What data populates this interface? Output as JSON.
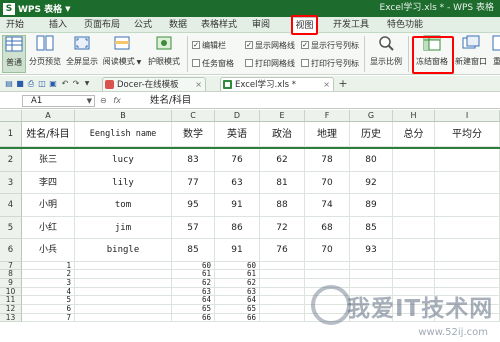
{
  "app": {
    "menu_button": "WPS 表格",
    "title": "Excel学习.xls * - WPS 表格"
  },
  "menu_tabs": [
    "开始",
    "插入",
    "页面布局",
    "公式",
    "数据",
    "表格样式",
    "审阅",
    "视图",
    "开发工具",
    "特色功能"
  ],
  "active_tab": "视图",
  "ribbon": {
    "normal": "普通",
    "page_break": "分页预览",
    "fullscreen": "全屏显示",
    "read_mode": "阅读模式",
    "eye_mode": "护眼模式",
    "checkboxes": [
      {
        "label": "编辑栏",
        "checked": true
      },
      {
        "label": "任务窗格",
        "checked": false
      },
      {
        "label": "显示网格线",
        "checked": true
      },
      {
        "label": "打印网格线",
        "checked": false
      },
      {
        "label": "显示行号列标",
        "checked": true
      },
      {
        "label": "打印行号列标",
        "checked": false
      }
    ],
    "zoom": "显示比例",
    "freeze": "冻结窗格",
    "new_window": "新建窗口",
    "arrange": "重"
  },
  "doc_tabs": [
    {
      "label": "Docer-在线模板",
      "active": false
    },
    {
      "label": "Excel学习.xls *",
      "active": true
    }
  ],
  "formula_bar": {
    "cell_ref": "A1",
    "fx": "fx",
    "content": "姓名/科目"
  },
  "columns": [
    "A",
    "B",
    "C",
    "D",
    "E",
    "F",
    "G",
    "H",
    "I"
  ],
  "header_row": [
    "姓名/科目",
    "Eenglish name",
    "数学",
    "英语",
    "政治",
    "地理",
    "历史",
    "总分",
    "平均分"
  ],
  "data_rows": [
    [
      "张三",
      "lucy",
      "83",
      "76",
      "62",
      "78",
      "80",
      "",
      ""
    ],
    [
      "李四",
      "lily",
      "77",
      "63",
      "81",
      "70",
      "92",
      "",
      ""
    ],
    [
      "小明",
      "tom",
      "95",
      "91",
      "88",
      "74",
      "89",
      "",
      ""
    ],
    [
      "小红",
      "jim",
      "57",
      "86",
      "72",
      "68",
      "85",
      "",
      ""
    ],
    [
      "小兵",
      "bingle",
      "85",
      "91",
      "76",
      "70",
      "93",
      "",
      ""
    ]
  ],
  "lower_rows": [
    [
      "7",
      "1",
      "60",
      "60"
    ],
    [
      "8",
      "2",
      "61",
      "61"
    ],
    [
      "9",
      "3",
      "62",
      "62"
    ],
    [
      "10",
      "4",
      "63",
      "63"
    ],
    [
      "11",
      "5",
      "64",
      "64"
    ],
    [
      "12",
      "6",
      "65",
      "65"
    ],
    [
      "13",
      "7",
      "66",
      "66"
    ]
  ],
  "colors": {
    "accent": "#1e6b2e",
    "highlight": "#ff0000",
    "freeze_line": "#2d7d3f"
  },
  "watermark": {
    "text": "我爱IT技术网",
    "url": "www.52ij.com"
  }
}
